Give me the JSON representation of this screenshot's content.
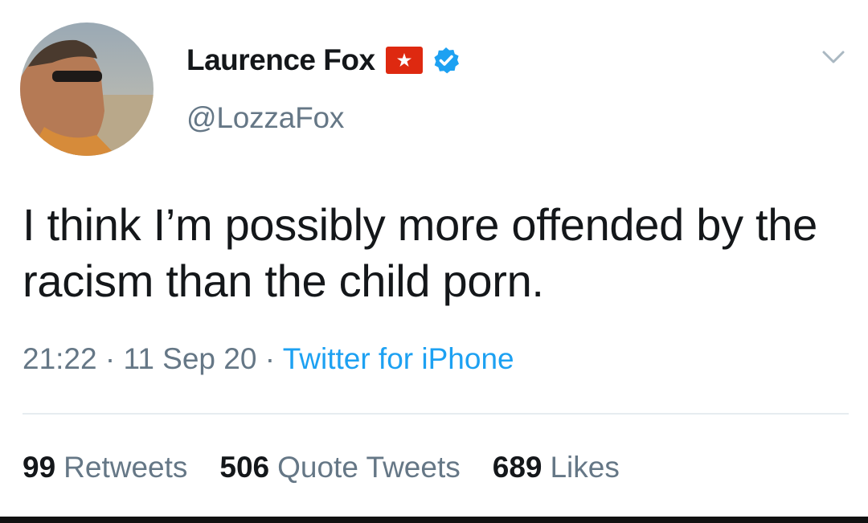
{
  "user": {
    "display_name": "Laurence Fox",
    "handle": "@LozzaFox"
  },
  "tweet": {
    "text": "I think I’m possibly more offended by the racism than the child porn.",
    "time": "21:22",
    "date": "11 Sep 20",
    "separator": "·",
    "source": "Twitter for iPhone"
  },
  "stats": {
    "retweets_count": "99",
    "retweets_label": "Retweets",
    "quotes_count": "506",
    "quotes_label": "Quote Tweets",
    "likes_count": "689",
    "likes_label": "Likes"
  },
  "icons": {
    "flag": "hong-kong-flag-icon",
    "verified": "verified-badge-icon",
    "menu": "chevron-down-icon"
  },
  "colors": {
    "text": "#14171a",
    "secondary": "#657786",
    "link": "#1da1f2",
    "verified": "#1da1f2",
    "flag_red": "#de2910"
  }
}
